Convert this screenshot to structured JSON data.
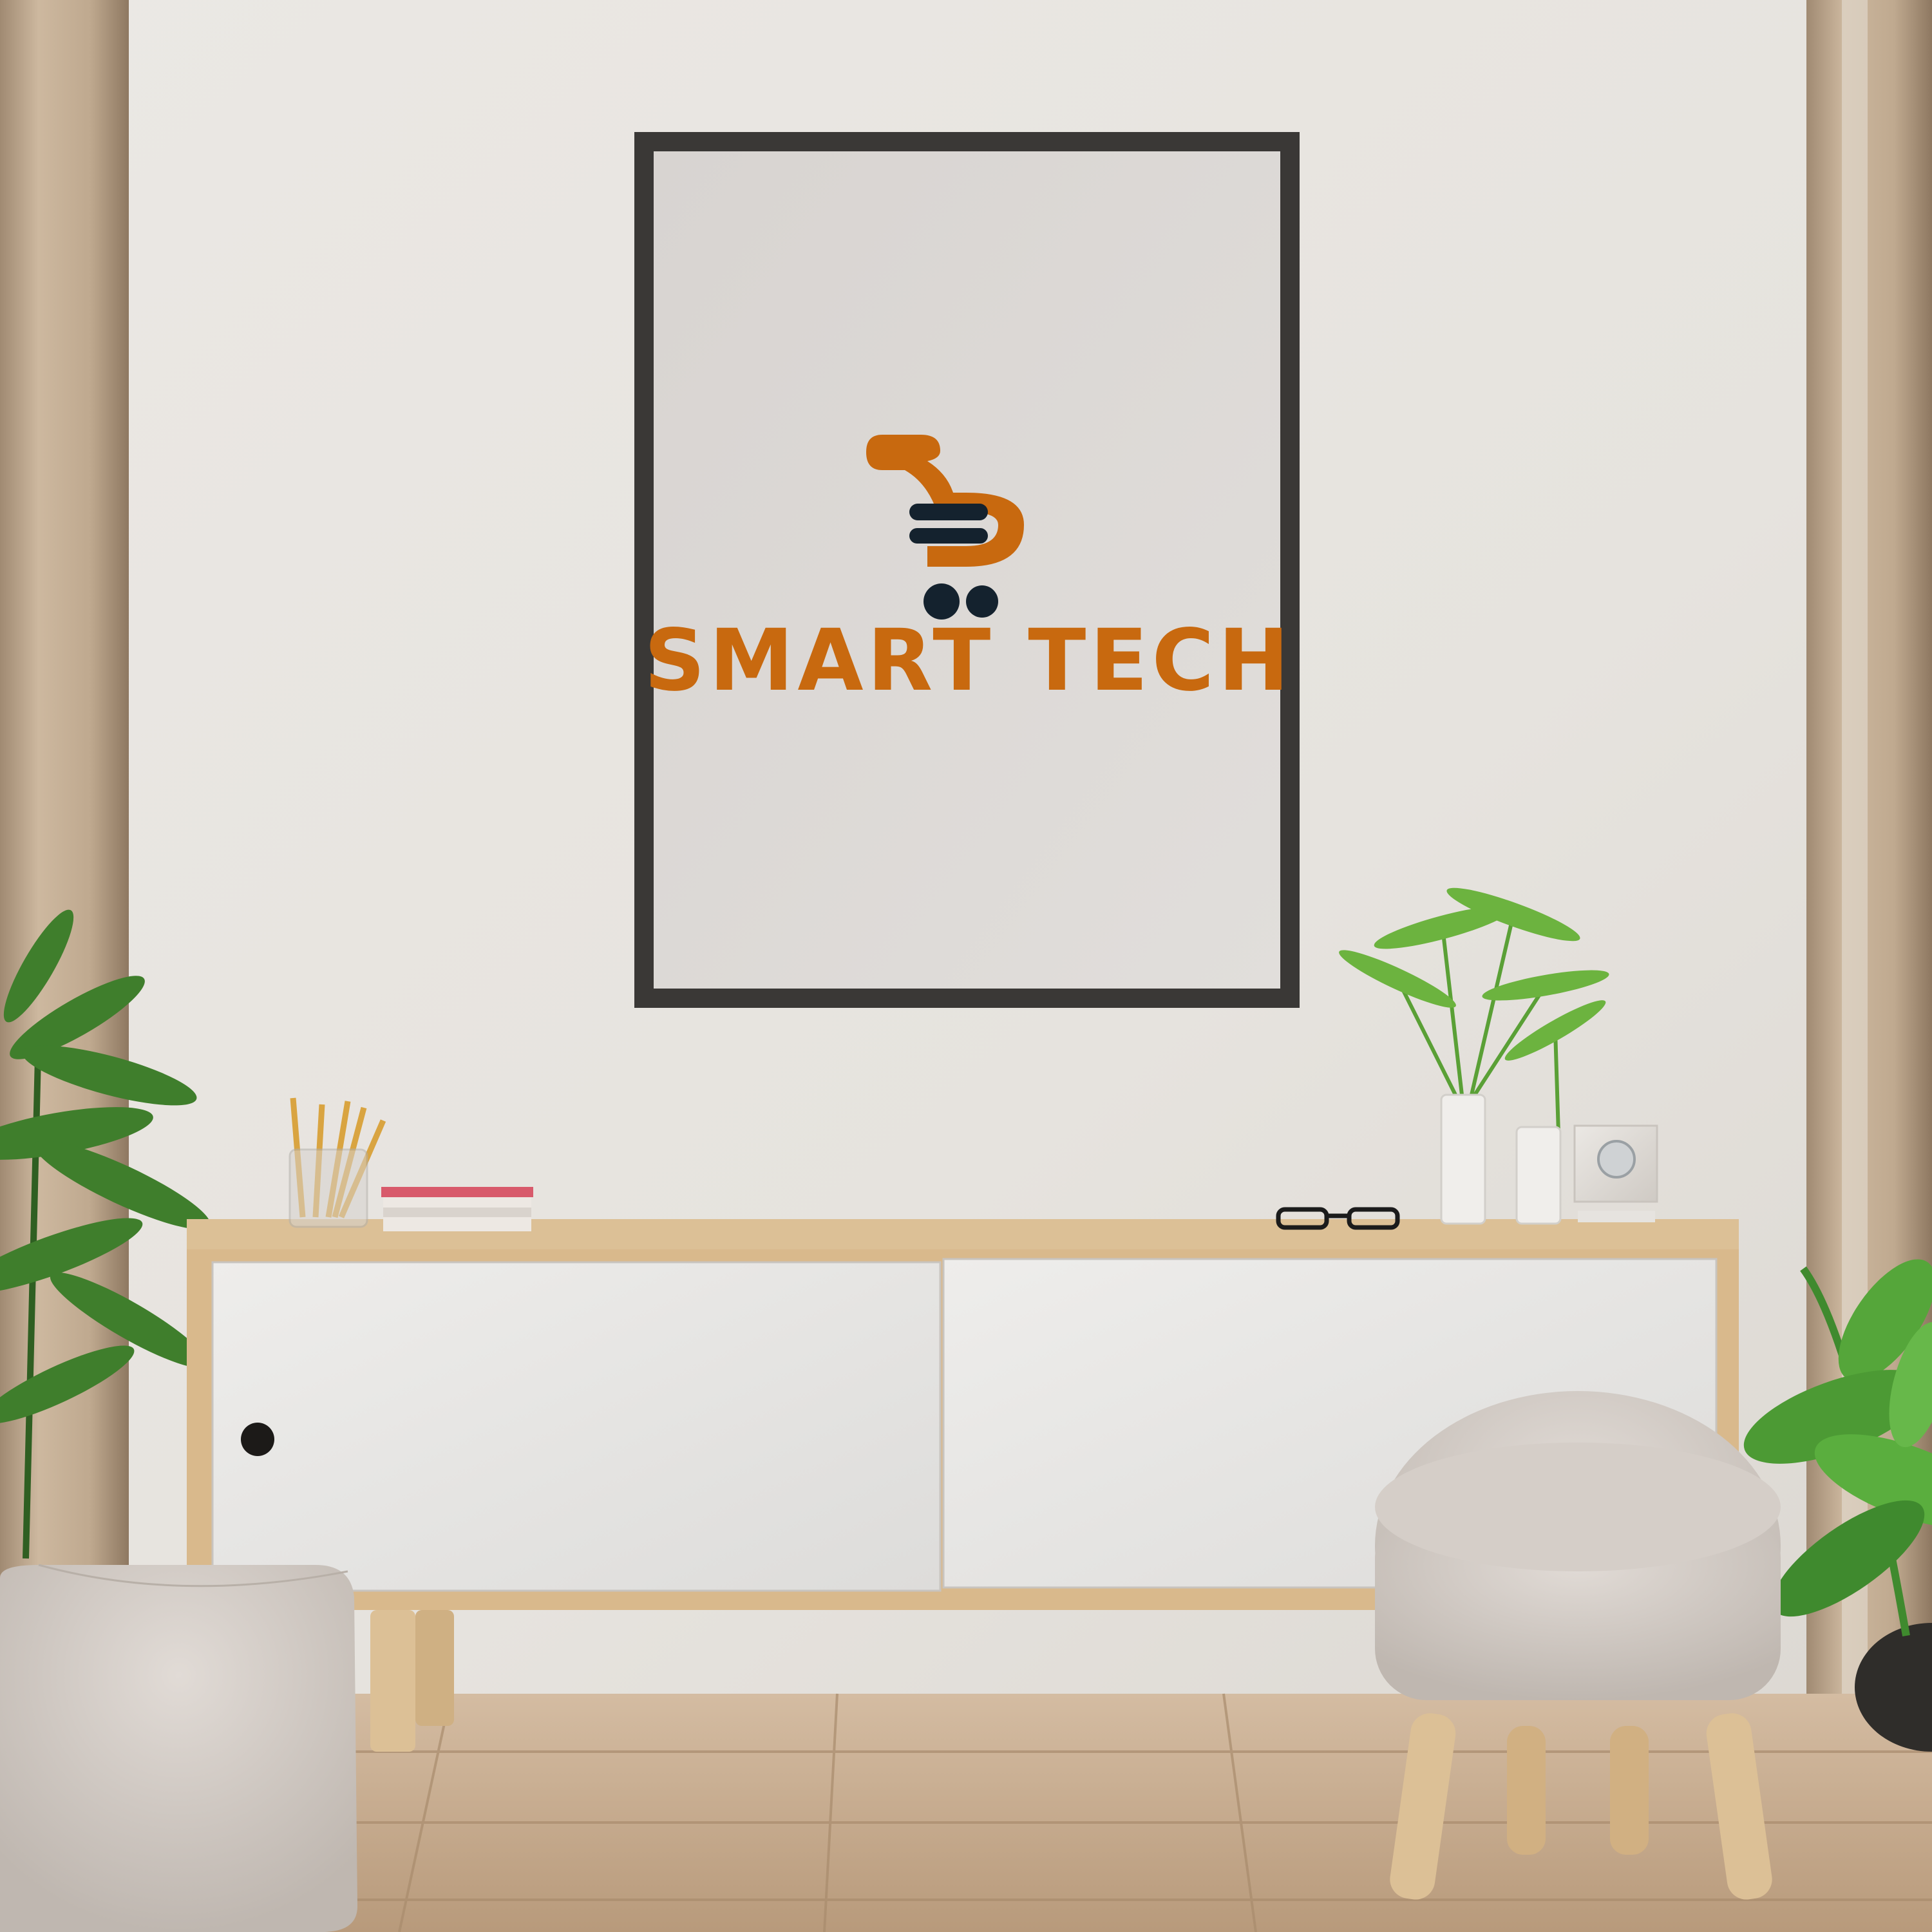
{
  "poster": {
    "brand_name": "SMART TECH",
    "logo_icon": "shopping-cart-icon"
  },
  "colors": {
    "wall": "#ebe8e4",
    "poster_frame": "#3a3836",
    "poster_paper": "#dcd9d6",
    "brand_orange": "#c8690f",
    "brand_navy": "#14222e",
    "wood": "#d9b98c",
    "cabinet_door": "#e7e6e4",
    "floor": "#c8ad8f",
    "plant_green": "#3f8a2e"
  }
}
